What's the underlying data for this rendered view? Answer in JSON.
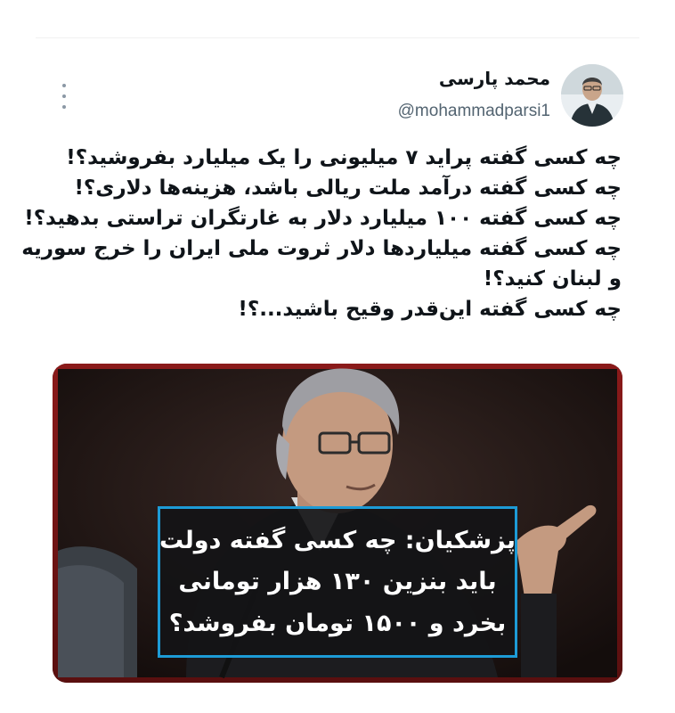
{
  "tweet": {
    "author": {
      "display_name": "محمد پارسی",
      "handle": "@mohammadparsi1"
    },
    "more_icon": "more-vertical-icon",
    "text_lines": [
      "چه کسی گفته پراید ۷ میلیونی را یک میلیارد بفروشید؟!",
      "چه کسی گفته درآمد ملت ریالی باشد، هزینه‌ها دلاری؟!",
      "چه کسی گفته ۱۰۰ میلیارد دلار به غارتگران تراستی بدهید؟!",
      "چه کسی گفته میلیاردها دلار ثروت ملی ایران را خرج سوریه",
      "و لبنان کنید؟!",
      "چه کسی گفته این‌قدر وقیح باشید...؟!"
    ],
    "media": {
      "caption_lines": [
        "پزشکیان: چه کسی گفته دولت",
        "باید بنزین ۱۳۰ هزار تومانی",
        "بخرد و ۱۵۰۰ تومان بفروشد؟"
      ],
      "caption_border_color": "#1d9bd6",
      "frame_color": "#8b1a1a"
    }
  }
}
